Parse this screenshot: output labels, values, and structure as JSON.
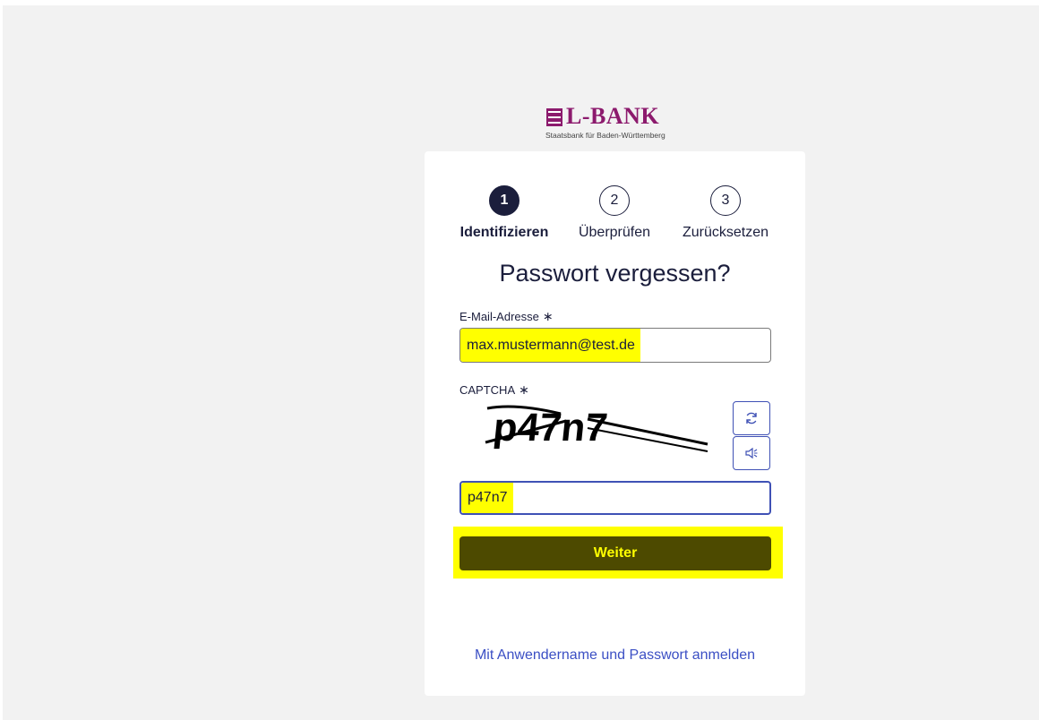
{
  "logo": {
    "name": "L-BANK",
    "subtitle": "Staatsbank für Baden-Württemberg"
  },
  "steps": [
    {
      "number": "1",
      "label": "Identifizieren",
      "active": true
    },
    {
      "number": "2",
      "label": "Überprüfen",
      "active": false
    },
    {
      "number": "3",
      "label": "Zurücksetzen",
      "active": false
    }
  ],
  "form": {
    "title": "Passwort vergessen?",
    "email_label": "E-Mail-Adresse",
    "email_value": "max.mustermann@test.de",
    "captcha_label": "CAPTCHA",
    "captcha_text": "p47n7",
    "captcha_value": "p47n7",
    "required_mark": "∗",
    "submit_label": "Weiter",
    "refresh_icon": "refresh-icon",
    "audio_icon": "speaker-icon"
  },
  "footer_link": "Mit Anwendername und Passwort anmelden",
  "colors": {
    "brand": "#8c1a6d",
    "navy": "#1b1e3c",
    "link": "#3b4fc4",
    "highlight": "#ffff00",
    "button_bg": "#4d4a00"
  }
}
